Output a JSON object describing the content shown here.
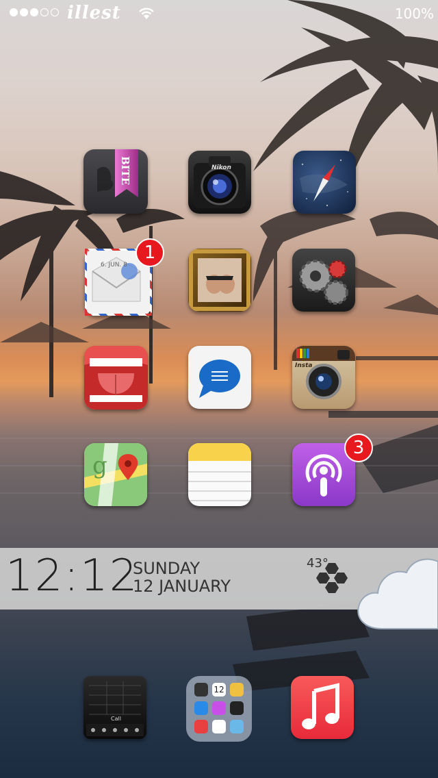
{
  "status_bar": {
    "carrier": "illest",
    "battery": "100%"
  },
  "apps": [
    {
      "name": "Bite",
      "label": "BITE",
      "icon": "bookmark-ribbon-icon"
    },
    {
      "name": "Camera",
      "label": "Nikon",
      "icon": "dslr-camera-icon"
    },
    {
      "name": "Safari",
      "icon": "compass-icon"
    },
    {
      "name": "Mail",
      "label": "6. JUN. 8",
      "badge": "1",
      "icon": "envelope-icon"
    },
    {
      "name": "Photos",
      "icon": "picture-frame-icon"
    },
    {
      "name": "Settings",
      "icon": "gears-icon"
    },
    {
      "name": "Mouth",
      "icon": "mouth-icon"
    },
    {
      "name": "Messages",
      "icon": "speech-bubble-icon"
    },
    {
      "name": "Instagram",
      "label": "Insta",
      "icon": "instagram-camera-icon"
    },
    {
      "name": "Maps",
      "icon": "map-pin-icon"
    },
    {
      "name": "Notes",
      "icon": "notepad-icon"
    },
    {
      "name": "Podcasts",
      "badge": "3",
      "icon": "podcast-icon"
    }
  ],
  "widget": {
    "time": "12:12",
    "day": "SUNDAY",
    "date": "12 JANUARY",
    "temperature": "43°",
    "weather_icon": "cloud-icon"
  },
  "dock": [
    {
      "name": "Phone",
      "label": "Call",
      "icon": "keypad-phone-icon"
    },
    {
      "name": "Folder",
      "folder_label": "12",
      "icon": "folder-icon"
    },
    {
      "name": "Music",
      "icon": "music-note-icon"
    }
  ],
  "colors": {
    "badge": "#e8181f",
    "widget_bg": "#cdcdcd",
    "music": "#f0353f",
    "podcast": "#a44ad6"
  }
}
